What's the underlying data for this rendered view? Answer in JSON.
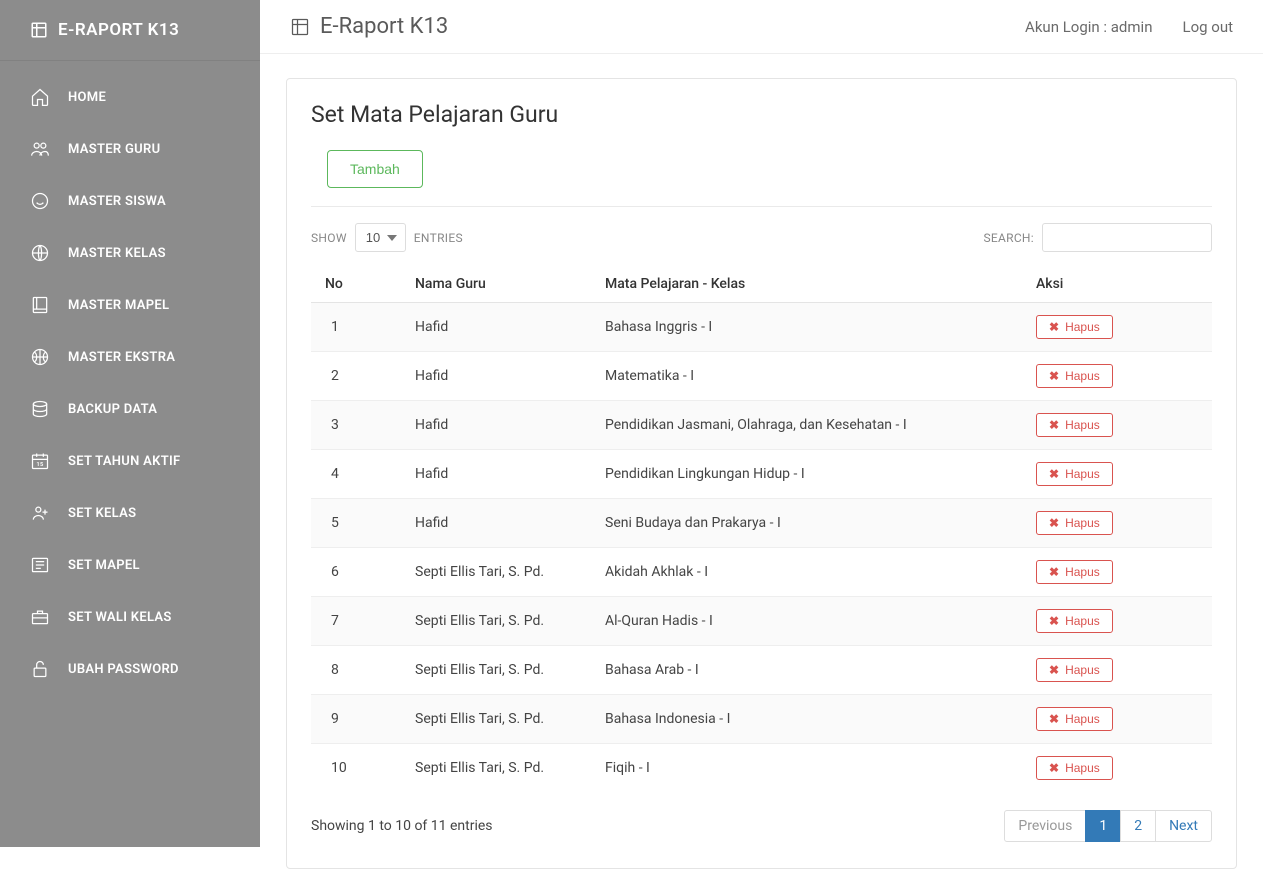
{
  "brand": "E-RAPORT K13",
  "sidebar": {
    "items": [
      {
        "label": "HOME"
      },
      {
        "label": "MASTER GURU"
      },
      {
        "label": "MASTER SISWA"
      },
      {
        "label": "MASTER KELAS"
      },
      {
        "label": "MASTER MAPEL"
      },
      {
        "label": "MASTER EKSTRA"
      },
      {
        "label": "BACKUP DATA"
      },
      {
        "label": "SET TAHUN AKTIF"
      },
      {
        "label": "SET KELAS"
      },
      {
        "label": "SET MAPEL"
      },
      {
        "label": "SET WALI KELAS"
      },
      {
        "label": "UBAH PASSWORD"
      }
    ]
  },
  "topbar": {
    "title": "E-Raport K13",
    "account": "Akun Login : admin",
    "logout": "Log out"
  },
  "page": {
    "title": "Set Mata Pelajaran Guru",
    "add_button": "Tambah"
  },
  "table": {
    "length_show": "SHOW",
    "length_entries": "ENTRIES",
    "length_value": "10",
    "search_label": "SEARCH:",
    "search_value": "",
    "headers": {
      "no": "No",
      "guru": "Nama Guru",
      "mapel": "Mata Pelajaran - Kelas",
      "aksi": "Aksi"
    },
    "delete_label": "Hapus",
    "rows": [
      {
        "no": "1",
        "guru": "Hafid",
        "mapel": "Bahasa Inggris - I"
      },
      {
        "no": "2",
        "guru": "Hafid",
        "mapel": "Matematika - I"
      },
      {
        "no": "3",
        "guru": "Hafid",
        "mapel": "Pendidikan Jasmani, Olahraga, dan Kesehatan - I"
      },
      {
        "no": "4",
        "guru": "Hafid",
        "mapel": "Pendidikan Lingkungan Hidup - I"
      },
      {
        "no": "5",
        "guru": "Hafid",
        "mapel": "Seni Budaya dan Prakarya - I"
      },
      {
        "no": "6",
        "guru": "Septi Ellis Tari, S. Pd.",
        "mapel": "Akidah Akhlak - I"
      },
      {
        "no": "7",
        "guru": "Septi Ellis Tari, S. Pd.",
        "mapel": "Al-Quran Hadis - I"
      },
      {
        "no": "8",
        "guru": "Septi Ellis Tari, S. Pd.",
        "mapel": "Bahasa Arab - I"
      },
      {
        "no": "9",
        "guru": "Septi Ellis Tari, S. Pd.",
        "mapel": "Bahasa Indonesia - I"
      },
      {
        "no": "10",
        "guru": "Septi Ellis Tari, S. Pd.",
        "mapel": "Fiqih - I"
      }
    ],
    "info": "Showing 1 to 10 of 11 entries",
    "pagination": {
      "previous": "Previous",
      "next": "Next",
      "pages": [
        "1",
        "2"
      ],
      "active": "1"
    }
  }
}
